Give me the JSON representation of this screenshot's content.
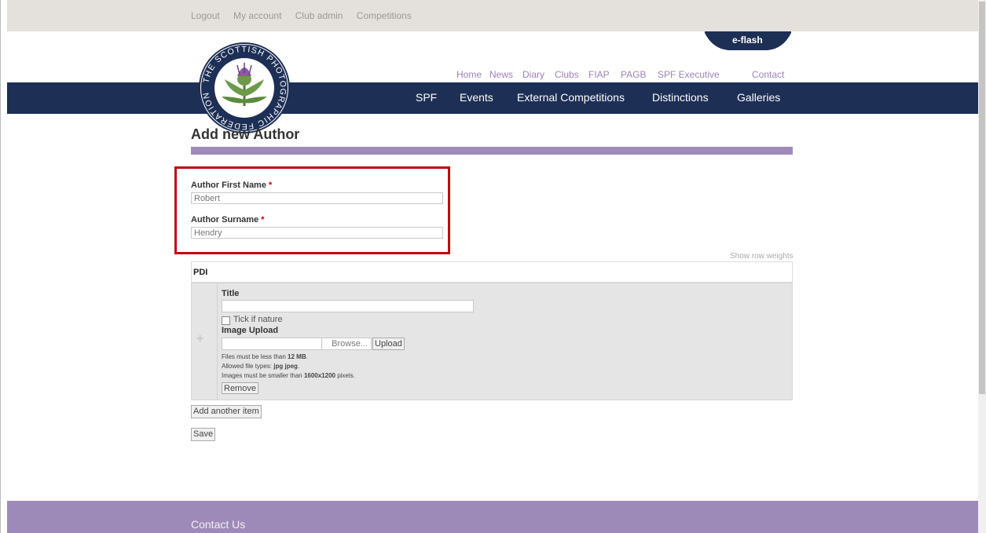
{
  "top_links": [
    "Logout",
    "My account",
    "Club admin",
    "Competitions"
  ],
  "eflash": "e-flash",
  "secondary_nav": [
    "Home",
    "News",
    "Diary",
    "Clubs",
    "FIAP",
    "PAGB",
    "SPF Executive",
    "Contact"
  ],
  "main_nav": [
    "SPF",
    "Events",
    "External Competitions",
    "Distinctions",
    "Galleries"
  ],
  "logo": {
    "ring_text": "THE SCOTTISH PHOTOGRAPHIC FEDERATION"
  },
  "page": {
    "title": "Add new Author"
  },
  "form": {
    "first_name_label": "Author First Name",
    "first_name_value": "Robert",
    "surname_label": "Author Surname",
    "surname_value": "Hendry",
    "required_mark": "*",
    "show_row_weights": "Show row weights",
    "pdi_header": "PDI",
    "title_label": "Title",
    "title_value": "",
    "nature_label": "Tick if nature",
    "image_upload_label": "Image Upload",
    "browse_label": "Browse...",
    "upload_label": "Upload",
    "help": {
      "size_prefix": "Files must be less than ",
      "size_value": "12 MB",
      "size_suffix": ".",
      "types_prefix": "Allowed file types: ",
      "types_value": "jpg jpeg",
      "types_suffix": ".",
      "dims_prefix": "Images must be smaller than ",
      "dims_value": "1600x1200",
      "dims_suffix": " pixels."
    },
    "remove_label": "Remove",
    "add_another_label": "Add another item",
    "save_label": "Save"
  },
  "footer": {
    "contact": "Contact Us"
  },
  "colors": {
    "navy": "#1d2f55",
    "purple": "#9e8ab8",
    "highlight": "#c0000f"
  }
}
